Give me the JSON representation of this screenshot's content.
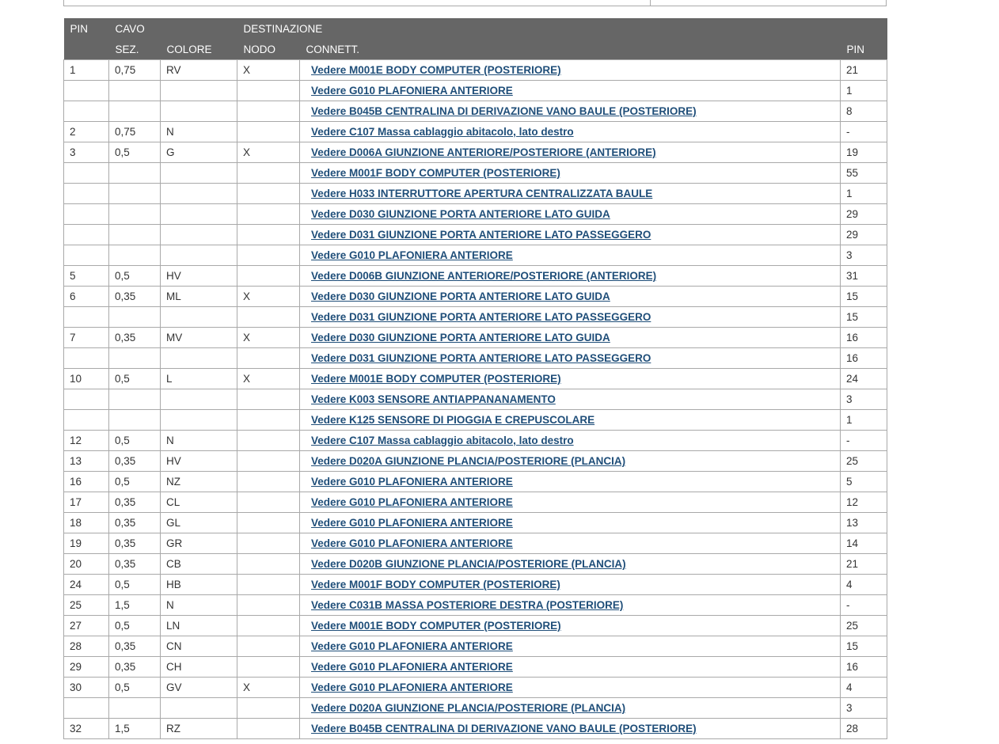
{
  "header": {
    "row1": {
      "pin": "PIN",
      "cavo": "CAVO",
      "destinazione": "DESTINAZIONE"
    },
    "row2": {
      "sez": "SEZ.",
      "colore": "COLORE",
      "nodo": "NODO",
      "connett": "CONNETT.",
      "pin": "PIN"
    }
  },
  "rows": [
    {
      "pin": "1",
      "sez": "0,75",
      "colore": "RV",
      "nodo": "X",
      "connett": " Vedere M001E BODY COMPUTER (POSTERIORE)",
      "dest_pin": "21"
    },
    {
      "pin": "",
      "sez": "",
      "colore": "",
      "nodo": "",
      "connett": " Vedere G010 PLAFONIERA ANTERIORE",
      "dest_pin": "1"
    },
    {
      "pin": "",
      "sez": "",
      "colore": "",
      "nodo": "",
      "connett": " Vedere B045B CENTRALINA DI DERIVAZIONE VANO BAULE (POSTERIORE)",
      "dest_pin": "8"
    },
    {
      "pin": "2",
      "sez": "0,75",
      "colore": "N",
      "nodo": "",
      "connett": " Vedere C107 Massa cablaggio abitacolo, lato destro",
      "dest_pin": "-"
    },
    {
      "pin": "3",
      "sez": "0,5",
      "colore": "G",
      "nodo": "X",
      "connett": " Vedere D006A GIUNZIONE ANTERIORE/POSTERIORE (ANTERIORE)",
      "dest_pin": "19"
    },
    {
      "pin": "",
      "sez": "",
      "colore": "",
      "nodo": "",
      "connett": " Vedere M001F BODY COMPUTER (POSTERIORE)",
      "dest_pin": "55"
    },
    {
      "pin": "",
      "sez": "",
      "colore": "",
      "nodo": "",
      "connett": " Vedere H033 INTERRUTTORE APERTURA CENTRALIZZATA BAULE",
      "dest_pin": "1"
    },
    {
      "pin": "",
      "sez": "",
      "colore": "",
      "nodo": "",
      "connett": " Vedere D030 GIUNZIONE PORTA ANTERIORE LATO GUIDA",
      "dest_pin": "29"
    },
    {
      "pin": "",
      "sez": "",
      "colore": "",
      "nodo": "",
      "connett": " Vedere D031 GIUNZIONE PORTA ANTERIORE LATO PASSEGGERO",
      "dest_pin": "29"
    },
    {
      "pin": "",
      "sez": "",
      "colore": "",
      "nodo": "",
      "connett": " Vedere G010 PLAFONIERA ANTERIORE",
      "dest_pin": "3"
    },
    {
      "pin": "5",
      "sez": "0,5",
      "colore": "HV",
      "nodo": "",
      "connett": " Vedere D006B GIUNZIONE ANTERIORE/POSTERIORE (ANTERIORE)",
      "dest_pin": "31"
    },
    {
      "pin": "6",
      "sez": "0,35",
      "colore": "ML",
      "nodo": "X",
      "connett": " Vedere D030 GIUNZIONE PORTA ANTERIORE LATO GUIDA",
      "dest_pin": "15"
    },
    {
      "pin": "",
      "sez": "",
      "colore": "",
      "nodo": "",
      "connett": " Vedere D031 GIUNZIONE PORTA ANTERIORE LATO PASSEGGERO",
      "dest_pin": "15"
    },
    {
      "pin": "7",
      "sez": "0,35",
      "colore": "MV",
      "nodo": "X",
      "connett": " Vedere D030 GIUNZIONE PORTA ANTERIORE LATO GUIDA",
      "dest_pin": "16"
    },
    {
      "pin": "",
      "sez": "",
      "colore": "",
      "nodo": "",
      "connett": " Vedere D031 GIUNZIONE PORTA ANTERIORE LATO PASSEGGERO",
      "dest_pin": "16"
    },
    {
      "pin": "10",
      "sez": "0,5",
      "colore": "L",
      "nodo": "X",
      "connett": " Vedere M001E BODY COMPUTER (POSTERIORE)",
      "dest_pin": "24"
    },
    {
      "pin": "",
      "sez": "",
      "colore": "",
      "nodo": "",
      "connett": " Vedere K003 SENSORE ANTIAPPANANAMENTO",
      "dest_pin": "3"
    },
    {
      "pin": "",
      "sez": "",
      "colore": "",
      "nodo": "",
      "connett": " Vedere K125 SENSORE DI PIOGGIA E CREPUSCOLARE",
      "dest_pin": "1"
    },
    {
      "pin": "12",
      "sez": "0,5",
      "colore": "N",
      "nodo": "",
      "connett": " Vedere C107 Massa cablaggio abitacolo, lato destro",
      "dest_pin": "-"
    },
    {
      "pin": "13",
      "sez": "0,35",
      "colore": "HV",
      "nodo": "",
      "connett": " Vedere D020A GIUNZIONE PLANCIA/POSTERIORE (PLANCIA)",
      "dest_pin": "25"
    },
    {
      "pin": "16",
      "sez": "0,5",
      "colore": "NZ",
      "nodo": "",
      "connett": " Vedere G010 PLAFONIERA ANTERIORE",
      "dest_pin": "5"
    },
    {
      "pin": "17",
      "sez": "0,35",
      "colore": "CL",
      "nodo": "",
      "connett": " Vedere G010 PLAFONIERA ANTERIORE",
      "dest_pin": "12"
    },
    {
      "pin": "18",
      "sez": "0,35",
      "colore": "GL",
      "nodo": "",
      "connett": " Vedere G010 PLAFONIERA ANTERIORE",
      "dest_pin": "13"
    },
    {
      "pin": "19",
      "sez": "0,35",
      "colore": "GR",
      "nodo": "",
      "connett": " Vedere G010 PLAFONIERA ANTERIORE",
      "dest_pin": "14"
    },
    {
      "pin": "20",
      "sez": "0,35",
      "colore": "CB",
      "nodo": "",
      "connett": " Vedere D020B GIUNZIONE PLANCIA/POSTERIORE (PLANCIA)",
      "dest_pin": "21"
    },
    {
      "pin": "24",
      "sez": "0,5",
      "colore": "HB",
      "nodo": "",
      "connett": " Vedere M001F BODY COMPUTER (POSTERIORE)",
      "dest_pin": "4"
    },
    {
      "pin": "25",
      "sez": "1,5",
      "colore": "N",
      "nodo": "",
      "connett": " Vedere C031B MASSA POSTERIORE DESTRA (POSTERIORE)",
      "dest_pin": "-"
    },
    {
      "pin": "27",
      "sez": "0,5",
      "colore": "LN",
      "nodo": "",
      "connett": " Vedere M001E BODY COMPUTER (POSTERIORE)",
      "dest_pin": "25"
    },
    {
      "pin": "28",
      "sez": "0,35",
      "colore": "CN",
      "nodo": "",
      "connett": " Vedere G010 PLAFONIERA ANTERIORE",
      "dest_pin": "15"
    },
    {
      "pin": "29",
      "sez": "0,35",
      "colore": "CH",
      "nodo": "",
      "connett": " Vedere G010 PLAFONIERA ANTERIORE",
      "dest_pin": "16"
    },
    {
      "pin": "30",
      "sez": "0,5",
      "colore": "GV",
      "nodo": "X",
      "connett": " Vedere G010 PLAFONIERA ANTERIORE",
      "dest_pin": "4"
    },
    {
      "pin": "",
      "sez": "",
      "colore": "",
      "nodo": "",
      "connett": " Vedere D020A GIUNZIONE PLANCIA/POSTERIORE (PLANCIA)",
      "dest_pin": "3"
    },
    {
      "pin": "32",
      "sez": "1,5",
      "colore": "RZ",
      "nodo": "",
      "connett": " Vedere B045B CENTRALINA DI DERIVAZIONE VANO BAULE (POSTERIORE)",
      "dest_pin": "28"
    }
  ]
}
